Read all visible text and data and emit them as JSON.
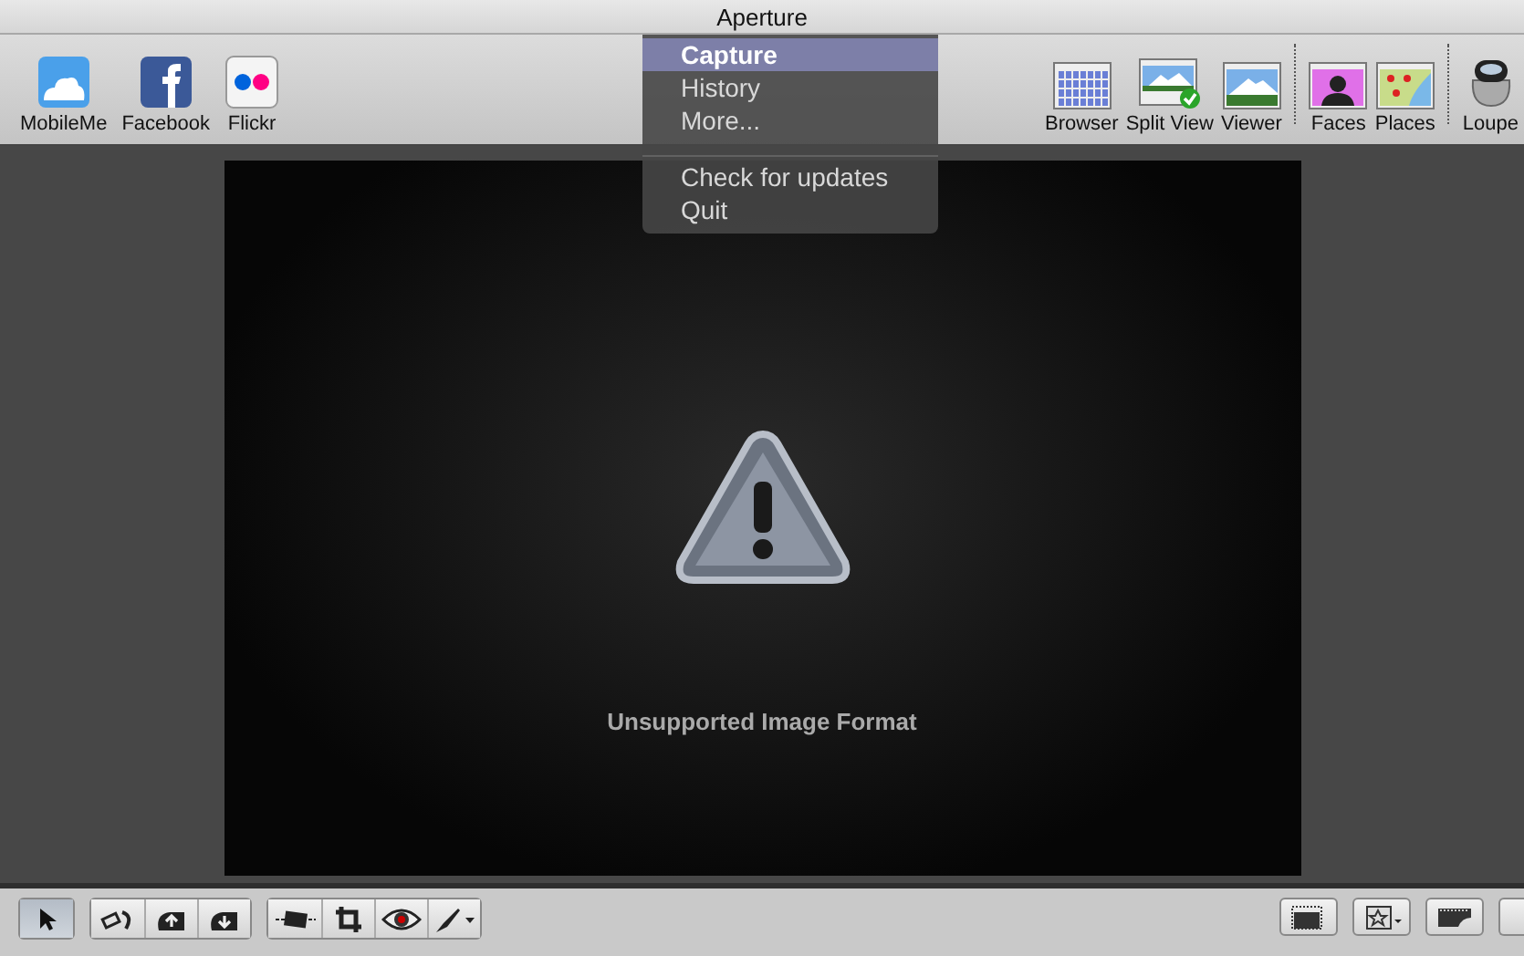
{
  "window": {
    "title": "Aperture"
  },
  "toolbar": {
    "share_items": [
      {
        "label": "MobileMe",
        "kind": "cloud"
      },
      {
        "label": "Facebook",
        "kind": "facebook"
      },
      {
        "label": "Flickr",
        "kind": "flickr"
      }
    ],
    "view_groups": [
      [
        {
          "label": "Browser",
          "kind": "grid"
        },
        {
          "label": "Split View",
          "kind": "split"
        },
        {
          "label": "Viewer",
          "kind": "viewer"
        }
      ],
      [
        {
          "label": "Faces",
          "kind": "faces"
        },
        {
          "label": "Places",
          "kind": "map"
        }
      ],
      [
        {
          "label": "Loupe",
          "kind": "loupe"
        }
      ]
    ]
  },
  "menu": {
    "groups": [
      [
        {
          "label": "Capture",
          "selected": true
        },
        {
          "label": "History",
          "selected": false
        },
        {
          "label": "More...",
          "selected": false
        }
      ],
      [
        {
          "label": "Check for updates",
          "selected": false
        },
        {
          "label": "Quit",
          "selected": false
        }
      ]
    ]
  },
  "viewer": {
    "message": "Unsupported Image Format"
  },
  "bottom_toolbar": {
    "left_groups": [
      [
        {
          "kind": "pointer",
          "selected": true
        }
      ],
      [
        {
          "kind": "rotate",
          "selected": false
        },
        {
          "kind": "lift",
          "selected": false
        },
        {
          "kind": "stamp",
          "selected": false
        }
      ],
      [
        {
          "kind": "straighten",
          "selected": false
        },
        {
          "kind": "crop",
          "selected": false
        },
        {
          "kind": "eye",
          "selected": false
        },
        {
          "kind": "brush",
          "selected": false
        }
      ]
    ],
    "right_buttons": [
      {
        "kind": "frame",
        "selected": false
      },
      {
        "kind": "star",
        "selected": false
      },
      {
        "kind": "filmstrip",
        "selected": false
      },
      {
        "kind": "blank",
        "selected": false
      }
    ]
  }
}
